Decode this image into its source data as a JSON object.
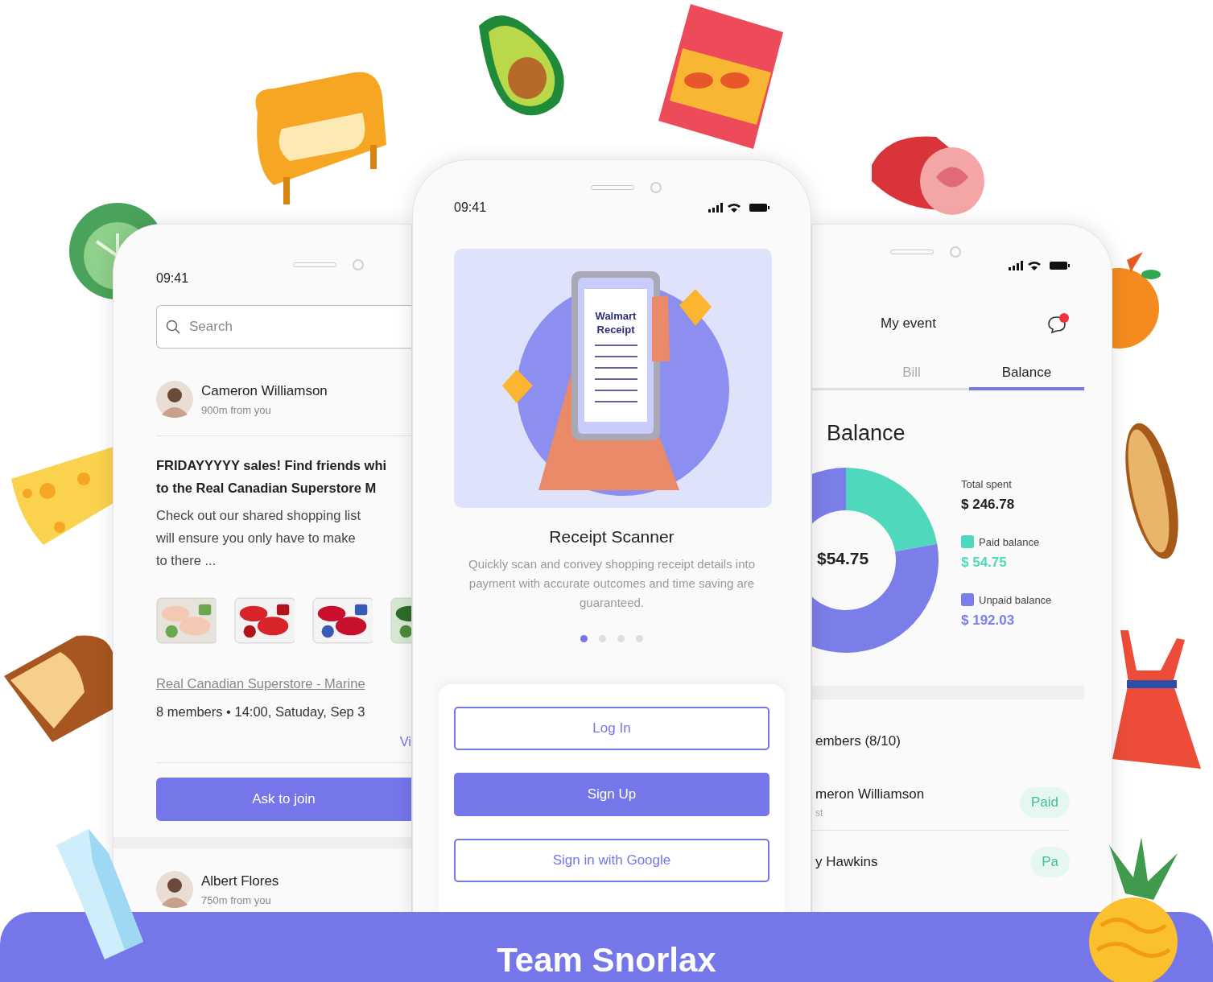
{
  "left_phone": {
    "time": "09:41",
    "search": {
      "placeholder": "Search"
    },
    "post": {
      "author": "Cameron Williamson",
      "distance": "900m from you",
      "headline_lines": [
        "FRIDAYYYYY sales! Find friends whi",
        "to the Real Canadian Superstore M"
      ],
      "body_lines": [
        "Check out our shared shopping list",
        "will ensure you only have to make",
        "to there ..."
      ],
      "products": [
        {
          "kind": "picture"
        },
        {
          "kind": "picture"
        },
        {
          "kind": "picture"
        },
        {
          "kind": "picture"
        }
      ],
      "store_link": "Real Canadian Superstore - Marine",
      "meta": "8 members • 14:00, Satuday, Sep 3",
      "view_link": "Vi",
      "join_button": "Ask to join"
    },
    "next_post": {
      "author": "Albert Flores",
      "distance": "750m from you"
    }
  },
  "center_phone": {
    "time": "09:41",
    "illustration_label_lines": [
      "Walmart",
      "Receipt"
    ],
    "title": "Receipt Scanner",
    "description": "Quickly scan and convey shopping receipt details into payment with accurate outcomes and time saving are guaranteed.",
    "pager_dots": [
      {
        "selected": true
      },
      {
        "selected": false
      },
      {
        "selected": false
      },
      {
        "selected": false
      }
    ],
    "buttons": [
      {
        "label": "Log In",
        "kind": "outline"
      },
      {
        "label": "Sign Up",
        "kind": "filled"
      },
      {
        "label": "Sign in with Google",
        "kind": "outline"
      }
    ]
  },
  "right_phone": {
    "title": "My event",
    "notification": {
      "unread": true
    },
    "tabs": [
      {
        "label": "Bill",
        "selected": false
      },
      {
        "label": "Balance",
        "selected": true
      }
    ],
    "heading": "Balance",
    "chart_data": {
      "type": "donut",
      "values": [
        22.2,
        77.8
      ]
    },
    "center_value": "$54.75",
    "total": {
      "label": "Total spent",
      "amount": "$ 246.78"
    },
    "legend": [
      {
        "label": "Paid balance",
        "amount": "$ 54.75",
        "color": "#4fd8bb"
      },
      {
        "label": "Unpaid balance",
        "amount": "$ 192.03",
        "color": "#7b7de9"
      }
    ],
    "members_heading": "embers (8/10)",
    "members": [
      {
        "name": "meron Williamson",
        "note": "st",
        "status": "Paid"
      },
      {
        "name": "y Hawkins",
        "status": "Pa"
      }
    ]
  },
  "banner": {
    "title": "Team Snorlax"
  }
}
